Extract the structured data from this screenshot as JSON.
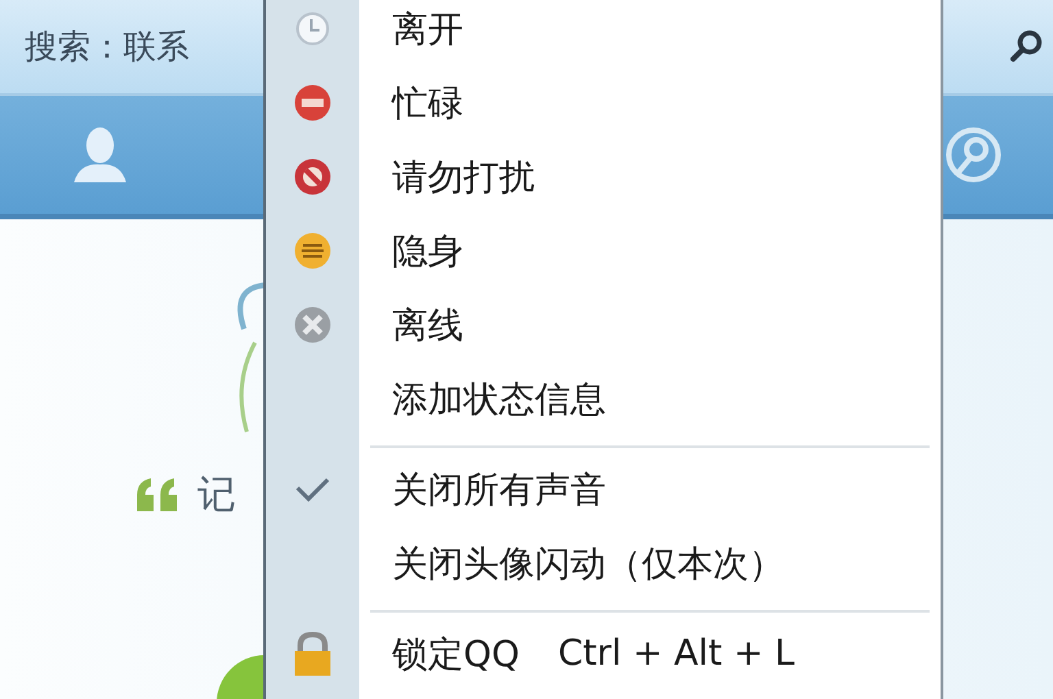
{
  "search": {
    "placeholder": "搜索：联系"
  },
  "content": {
    "quote_text": "记"
  },
  "menu": {
    "items": [
      {
        "kind": "away",
        "label": "离开"
      },
      {
        "kind": "busy",
        "label": "忙碌"
      },
      {
        "kind": "dnd",
        "label": "请勿打扰"
      },
      {
        "kind": "invisible",
        "label": "隐身"
      },
      {
        "kind": "offline",
        "label": "离线"
      },
      {
        "kind": "plain",
        "label": "添加状态信息"
      },
      {
        "kind": "separator"
      },
      {
        "kind": "toggle",
        "label": "关闭所有声音",
        "checked": true
      },
      {
        "kind": "toggle",
        "label": "关闭头像闪动（仅本次）",
        "checked": false
      },
      {
        "kind": "separator"
      },
      {
        "kind": "lock",
        "label": "锁定QQ",
        "shortcut": "Ctrl + Alt + L"
      }
    ]
  }
}
